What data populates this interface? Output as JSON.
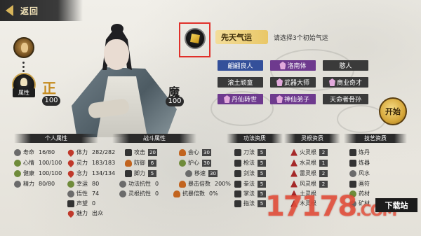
{
  "header": {
    "back_label": "返回"
  },
  "left_column": {
    "attr_label": "属性"
  },
  "character": {
    "righteous": {
      "label": "正",
      "value": "100"
    },
    "demonic": {
      "label": "魔",
      "value": "100"
    }
  },
  "fortune": {
    "tab_label": "先天气运",
    "tip": "请选择3个初始气运",
    "traits": [
      {
        "label": "翩翩良人",
        "style": "blue"
      },
      {
        "label": "洛南体",
        "style": "purple",
        "marked": true
      },
      {
        "label": "憨人",
        "style": "dark"
      },
      {
        "label": "滚土顽童",
        "style": "dark"
      },
      {
        "label": "武器大师",
        "style": "rb",
        "marked": true
      },
      {
        "label": "商业奇才",
        "style": "dark",
        "marked": true
      },
      {
        "label": "丹仙转世",
        "style": "purple",
        "marked": true
      },
      {
        "label": "神仙弟子",
        "style": "purple",
        "marked": true
      },
      {
        "label": "天命者骨孙",
        "style": "dark"
      }
    ]
  },
  "start_button": {
    "label": "开始"
  },
  "panels": {
    "personal": {
      "title": "个人属性",
      "rows": [
        {
          "label": "寿命",
          "value": "16/80"
        },
        {
          "label": "心情",
          "value": "100/100"
        },
        {
          "label": "健康",
          "value": "100/100"
        },
        {
          "label": "精力",
          "value": "80/80"
        }
      ],
      "rows2": [
        {
          "label": "体力",
          "value": "282/282"
        },
        {
          "label": "灵力",
          "value": "183/183"
        },
        {
          "label": "念力",
          "value": "134/134"
        },
        {
          "label": "幸运",
          "value": "80"
        },
        {
          "label": "悟性",
          "value": "74"
        },
        {
          "label": "声望",
          "value": "0"
        },
        {
          "label": "魅力",
          "value": "出众"
        }
      ]
    },
    "combat": {
      "title": "战斗属性",
      "rows": [
        {
          "label": "攻击",
          "value": "20"
        },
        {
          "label": "防御",
          "value": "6"
        },
        {
          "label": "脚力",
          "value": "5"
        },
        {
          "label": "功法抗性",
          "value": "0"
        },
        {
          "label": "灵根抗性",
          "value": "0"
        }
      ],
      "rows2": [
        {
          "label": "会心",
          "value": "30"
        },
        {
          "label": "护心",
          "value": "30"
        },
        {
          "label": "移速",
          "value": "30"
        },
        {
          "label": "暴击倍数",
          "value": "200%"
        },
        {
          "label": "抗暴倍数",
          "value": "0%"
        }
      ]
    },
    "technique": {
      "title": "功法资质",
      "rows": [
        {
          "label": "刀法",
          "value": "5"
        },
        {
          "label": "枪法",
          "value": "5"
        },
        {
          "label": "剑法",
          "value": "5"
        },
        {
          "label": "拳法",
          "value": "5"
        },
        {
          "label": "掌法",
          "value": "5"
        },
        {
          "label": "指法",
          "value": "5"
        }
      ]
    },
    "roots": {
      "title": "灵根资质",
      "rows": [
        {
          "label": "火灵根",
          "value": "2"
        },
        {
          "label": "水灵根",
          "value": "1"
        },
        {
          "label": "雷灵根",
          "value": "2"
        },
        {
          "label": "风灵根",
          "value": "2"
        },
        {
          "label": "土灵根",
          "value": ""
        },
        {
          "label": "木灵根",
          "value": ""
        }
      ]
    },
    "skills": {
      "title": "技艺资质",
      "rows": [
        {
          "label": "炼丹",
          "value": ""
        },
        {
          "label": "炼器",
          "value": ""
        },
        {
          "label": "风水",
          "value": ""
        },
        {
          "label": "画符",
          "value": ""
        },
        {
          "label": "药材",
          "value": ""
        },
        {
          "label": "矿材",
          "value": ""
        }
      ]
    }
  },
  "watermark": {
    "text": "17178",
    "suffix": ".COM",
    "badge": "下载站"
  }
}
